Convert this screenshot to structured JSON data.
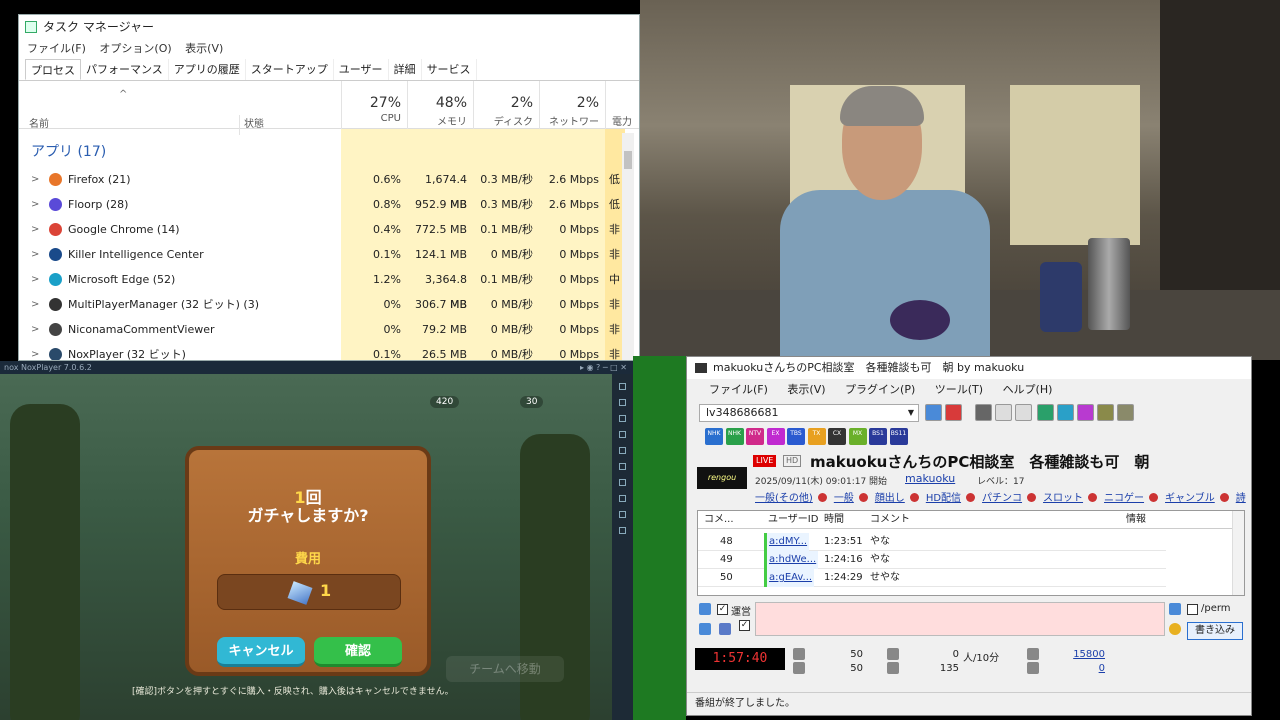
{
  "task_manager": {
    "title": "タスク マネージャー",
    "menu": [
      "ファイル(F)",
      "オプション(O)",
      "表示(V)"
    ],
    "tabs": [
      "プロセス",
      "パフォーマンス",
      "アプリの履歴",
      "スタートアップ",
      "ユーザー",
      "詳細",
      "サービス"
    ],
    "headers": {
      "name": "名前",
      "status": "状態",
      "cpu_pct": "27%",
      "cpu": "CPU",
      "mem_pct": "48%",
      "mem": "メモリ",
      "disk_pct": "2%",
      "disk": "ディスク",
      "net_pct": "2%",
      "net": "ネットワーク",
      "power": "電力"
    },
    "section": "アプリ (17)",
    "rows": [
      {
        "name": "Firefox (21)",
        "cpu": "0.6%",
        "mem": "1,674.4 MB",
        "disk": "0.3 MB/秒",
        "net": "2.6 Mbps",
        "power": "低",
        "color": "#e8762a"
      },
      {
        "name": "Floorp (28)",
        "cpu": "0.8%",
        "mem": "952.9 MB",
        "disk": "0.3 MB/秒",
        "net": "2.6 Mbps",
        "power": "低",
        "color": "#5a4ad8"
      },
      {
        "name": "Google Chrome (14)",
        "cpu": "0.4%",
        "mem": "772.5 MB",
        "disk": "0.1 MB/秒",
        "net": "0 Mbps",
        "power": "非",
        "color": "#db4437"
      },
      {
        "name": "Killer Intelligence Center",
        "cpu": "0.1%",
        "mem": "124.1 MB",
        "disk": "0 MB/秒",
        "net": "0 Mbps",
        "power": "非",
        "color": "#1a4a8a"
      },
      {
        "name": "Microsoft Edge (52)",
        "cpu": "1.2%",
        "mem": "3,364.8 MB",
        "disk": "0.1 MB/秒",
        "net": "0 Mbps",
        "power": "中",
        "color": "#1aa0c8"
      },
      {
        "name": "MultiPlayerManager (32 ビット) (3)",
        "cpu": "0%",
        "mem": "306.7 MB",
        "disk": "0 MB/秒",
        "net": "0 Mbps",
        "power": "非",
        "color": "#333"
      },
      {
        "name": "NiconamaCommentViewer",
        "cpu": "0%",
        "mem": "79.2 MB",
        "disk": "0 MB/秒",
        "net": "0 Mbps",
        "power": "非",
        "color": "#444"
      },
      {
        "name": "NoxPlayer (32 ビット)",
        "cpu": "0.1%",
        "mem": "26.5 MB",
        "disk": "0 MB/秒",
        "net": "0 Mbps",
        "power": "非",
        "color": "#2a4a6a"
      }
    ]
  },
  "nox": {
    "titlebar": "nox NoxPlayer 7.0.6.2",
    "res1": "420",
    "res2": "30",
    "dialog": {
      "count": "1",
      "q_suffix": "回",
      "q2": "ガチャしますか?",
      "cost_label": "費用",
      "cost_value": "1",
      "cancel": "キャンセル",
      "ok": "確認"
    },
    "team_button": "チームへ移動",
    "hint": "[確認]ボタンを押すとすぐに購入・反映され、購入後はキャンセルできません。"
  },
  "ncv": {
    "title": "makuokuさんちのPC相談室　各種雑談も可　朝 by makuoku",
    "menu": [
      "ファイル(F)",
      "表示(V)",
      "プラグイン(P)",
      "ツール(T)",
      "ヘルプ(H)"
    ],
    "live_id": "lv348686681",
    "channels": [
      {
        "label": "NHK",
        "color": "#2a6fcf"
      },
      {
        "label": "NHK",
        "color": "#2aa04a"
      },
      {
        "label": "NTV",
        "color": "#d02a8a"
      },
      {
        "label": "EX",
        "color": "#c02ad0"
      },
      {
        "label": "TBS",
        "color": "#2a5ad0"
      },
      {
        "label": "TX",
        "color": "#e8a020"
      },
      {
        "label": "CX",
        "color": "#333"
      },
      {
        "label": "MX",
        "color": "#6ab02a"
      },
      {
        "label": "BS1",
        "color": "#2a3a9a"
      },
      {
        "label": "BS11",
        "color": "#2a3a9a"
      }
    ],
    "logo": "rengou",
    "live_badge": "LIVE",
    "hd_badge": "HD",
    "stream_title": "makuokuさんちのPC相談室　各種雑談も可　朝",
    "start": "2025/09/11(木) 09:01:17 開始",
    "owner": "makuoku",
    "level": "レベル：17",
    "categories": [
      "一般(その他)",
      "一般",
      "顔出し",
      "HD配信",
      "パチンコ",
      "スロット",
      "ニコゲー",
      "ギャンブル",
      "詩"
    ],
    "grid_headers": {
      "no": "コメ...",
      "uid": "ユーザーID",
      "time": "時間",
      "comment": "コメント",
      "info": "情報"
    },
    "comments": [
      {
        "no": "48",
        "uid": "a:dMY...",
        "time": "1:23:51",
        "comment": "やな"
      },
      {
        "no": "49",
        "uid": "a:hdWe...",
        "time": "1:24:16",
        "comment": "やな"
      },
      {
        "no": "50",
        "uid": "a:gEAv...",
        "time": "1:24:29",
        "comment": "せやな"
      }
    ],
    "unei_label": "運営",
    "perm_label": "/perm",
    "post_button": "書き込み",
    "timer": "1:57:40",
    "stat_comments1": "50",
    "stat_comments2": "50",
    "stat_viewers": "0",
    "stat_per10": "人/10分",
    "stat_total": "135",
    "stat_link1": "15800",
    "stat_link2": "0",
    "status": "番組が終了しました。"
  }
}
